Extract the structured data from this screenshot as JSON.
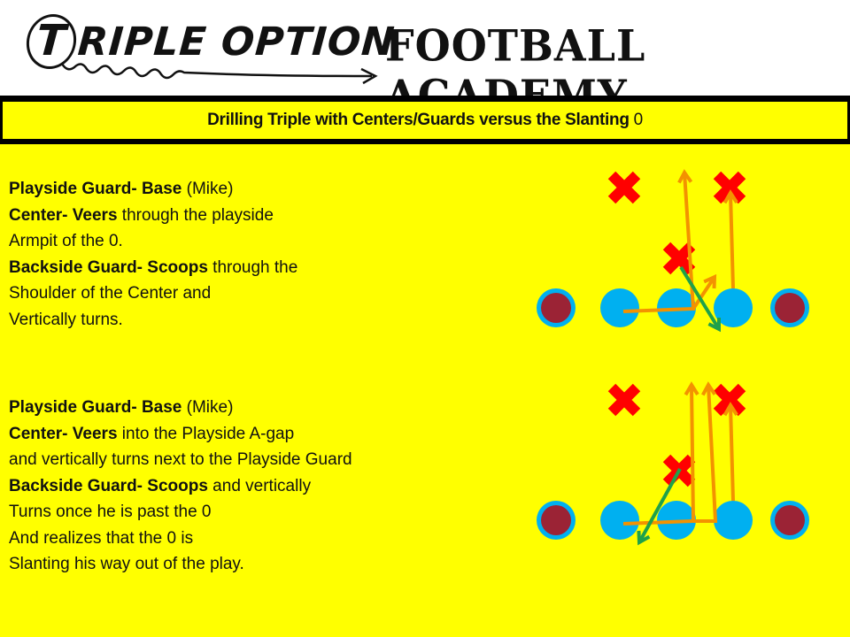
{
  "header": {
    "logo_left": "TRIPLE OPTION",
    "logo_left_first": "T",
    "logo_left_rest": "RIPLE OPTION",
    "logo_right": "FOOTBALL ACADEMY"
  },
  "banner": {
    "title_bold": "Drilling Triple with Centers/Guards versus the Slanting",
    "title_tail": " 0"
  },
  "drill_1": {
    "lines": [
      {
        "bold": "Playside Guard- Base",
        "text": " (Mike)"
      },
      {
        "bold": "Center- Veers",
        "text": " through the playside"
      },
      {
        "bold": "",
        "text": "Armpit of the 0."
      },
      {
        "bold": "Backside Guard- Scoops",
        "text": " through the"
      },
      {
        "bold": "",
        "text": "Shoulder of the Center and"
      },
      {
        "bold": "",
        "text": "Vertically turns."
      }
    ]
  },
  "drill_2": {
    "lines": [
      {
        "bold": "Playside Guard- Base",
        "text": " (Mike)"
      },
      {
        "bold": "Center-  Veers",
        "text": " into the Playside A-gap"
      },
      {
        "bold": "",
        "text": "and vertically turns next to the Playside Guard"
      },
      {
        "bold": "Backside Guard- Scoops",
        "text": " and vertically"
      },
      {
        "bold": "",
        "text": "Turns once he is past the 0"
      },
      {
        "bold": "",
        "text": "And realizes  that the 0 is"
      },
      {
        "bold": "",
        "text": "Slanting his way out of the play."
      }
    ]
  },
  "colors": {
    "background": "#ffff00",
    "offense_lineman": "#00b0f0",
    "offense_tackle_fill": "#9b2335",
    "defender": "#ff0000",
    "block_path": "#f39200",
    "defender_path": "#1fa14a"
  },
  "diagrams": [
    {
      "name": "diagram-veer-armpit",
      "offense": [
        "tackle",
        "guard",
        "center",
        "guard",
        "tackle"
      ],
      "defenders": [
        "linebacker-left",
        "linebacker-right",
        "nose-0"
      ],
      "paths": [
        {
          "player": "backside-guard",
          "action": "scoop then vertical",
          "color": "orange"
        },
        {
          "player": "center",
          "action": "veer through playside armpit",
          "color": "orange"
        },
        {
          "player": "playside-guard",
          "action": "base block Mike",
          "color": "orange"
        },
        {
          "player": "nose-0",
          "action": "slant to playside",
          "color": "green"
        }
      ]
    },
    {
      "name": "diagram-veer-a-gap",
      "offense": [
        "tackle",
        "guard",
        "center",
        "guard",
        "tackle"
      ],
      "defenders": [
        "linebacker-left",
        "linebacker-right",
        "nose-0"
      ],
      "paths": [
        {
          "player": "backside-guard",
          "action": "scoop then vertical",
          "color": "orange"
        },
        {
          "player": "center",
          "action": "veer into A-gap then vertical",
          "color": "orange"
        },
        {
          "player": "playside-guard",
          "action": "base block Mike",
          "color": "orange"
        },
        {
          "player": "nose-0",
          "action": "slant to backside",
          "color": "green"
        }
      ]
    }
  ]
}
